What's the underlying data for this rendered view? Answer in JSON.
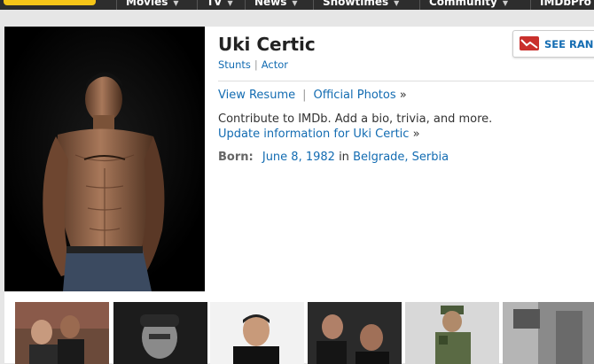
{
  "nav": {
    "items": [
      "Movies",
      "TV",
      "News",
      "Showtimes",
      "Community",
      "IMDbPro"
    ]
  },
  "person": {
    "name": "Uki Certic",
    "roles": [
      "Stunts",
      "Actor"
    ]
  },
  "links": {
    "resume": "View Resume",
    "photos": "Official Photos",
    "photos_arrow": "»"
  },
  "contribute": {
    "text": "Contribute to IMDb. Add a bio, trivia, and more.",
    "update_link": "Update information for Uki Certic",
    "arrow": "»"
  },
  "born": {
    "label": "Born:",
    "date": "June 8, 1982",
    "in": "in",
    "place": "Belgrade, Serbia"
  },
  "rank_button": {
    "label": "SEE RANK"
  },
  "colors": {
    "link": "#136cb2",
    "brand": "#f5c518",
    "nav_bg": "#2d2d2d"
  }
}
